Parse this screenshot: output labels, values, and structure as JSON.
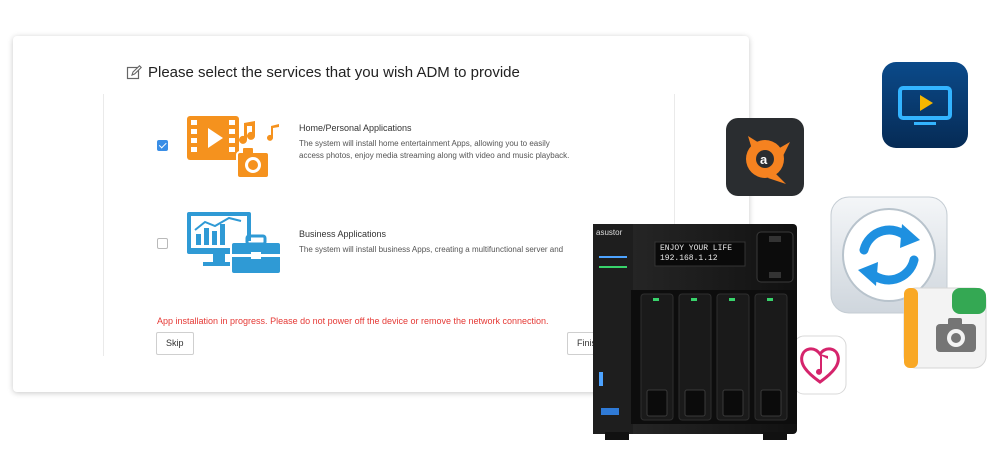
{
  "dialog": {
    "title": "Please select the services that you wish ADM to provide",
    "services": [
      {
        "title": "Home/Personal Applications",
        "description_line1": "The system will install home entertainment Apps, allowing you to easily",
        "description_line2": "access photos, enjoy media streaming along with video and music playback.",
        "checked": true
      },
      {
        "title": "Business Applications",
        "description_line1": "The system will install business Apps, creating a multifunctional server and",
        "checked": false
      }
    ],
    "warning": "App installation in progress. Please do not power off the device or remove the network connection.",
    "skip_label": "Skip",
    "finish_label": "Finish"
  },
  "device": {
    "brand": "asustor",
    "lcd_line1": "ENJOY YOUR LIFE",
    "lcd_line2": "192.168.1.12"
  },
  "colors": {
    "accent": "#3a8ee6",
    "warning": "#e53935",
    "home_icon": "#f5921e",
    "business_icon": "#2f9ad5"
  },
  "icons": [
    "edit-icon",
    "home-media-icon",
    "business-icon",
    "avast-app-icon",
    "video-player-app-icon",
    "sync-app-icon",
    "photo-app-icon",
    "music-app-icon"
  ]
}
